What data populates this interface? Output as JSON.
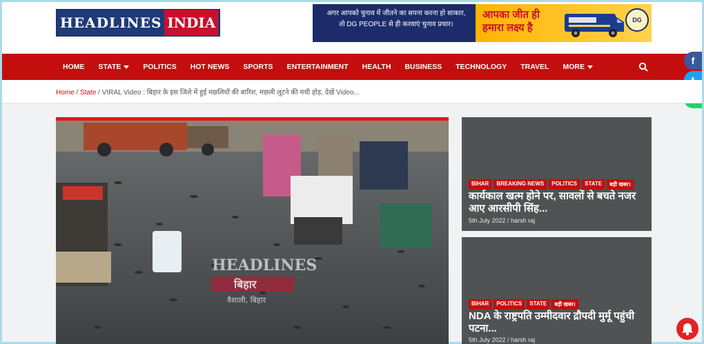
{
  "logo": {
    "part1": "HEADLINES",
    "part2": "INDIA"
  },
  "ad": {
    "line1": "अगर आपको चुनाव में जीतने का सपना करना हो साकार,",
    "line2": "तो DG PEOPLE से ही करवाएं चुनाव प्रचार।",
    "slogan": "आपका जीत ही हमारा लक्ष्य है",
    "badge": "DG"
  },
  "nav": {
    "items": [
      "HOME",
      "STATE",
      "POLITICS",
      "HOT NEWS",
      "SPORTS",
      "ENTERTAINMENT",
      "HEALTH",
      "BUSINESS",
      "TECHNOLOGY",
      "TRAVEL",
      "MORE"
    ]
  },
  "breadcrumb": {
    "home": "Home",
    "sep": " / ",
    "state": "State",
    "current": "VIRAL Video : बिहार के इस जिले में हुई मछलियों की बारिश, मछली लूटने की मची होड़, देखें Video..."
  },
  "hero": {
    "watermark_line1": "HEADLINES",
    "watermark_line2": "बिहार",
    "watermark_caption": "वैशाली, बिहार"
  },
  "cards": [
    {
      "tags": [
        "BIHAR",
        "BREAKING NEWS",
        "POLITICS",
        "STATE",
        "बड़ी खबर।"
      ],
      "title": "कार्यकाल खत्म होने पर, सावलों से बचते नजर आए आरसीपी सिंह...",
      "date": "5th July 2022",
      "author": "harsh raj"
    },
    {
      "tags": [
        "BIHAR",
        "POLITICS",
        "STATE",
        "बड़ी खबर।"
      ],
      "title": "NDA के राष्ट्रपति उम्मीदवार द्रौपदी मुर्मू पहुंची पटना...",
      "date": "5th July 2022",
      "author": "harsh raj"
    }
  ],
  "social": [
    "f",
    "t",
    "w"
  ],
  "colors": {
    "brand_red": "#c40e0e",
    "logo_blue": "#1f3a78",
    "ad_yellow": "#ffb300"
  }
}
